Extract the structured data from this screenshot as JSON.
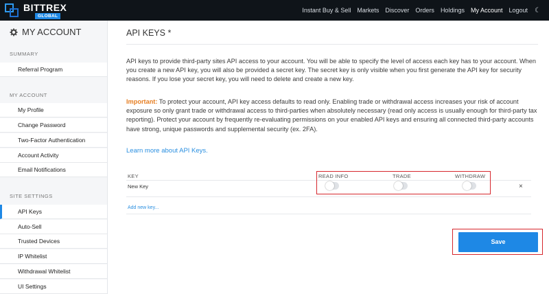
{
  "brand": {
    "name": "BITTREX",
    "sub": "GLOBAL"
  },
  "topnav": {
    "items": [
      "Instant Buy & Sell",
      "Markets",
      "Discover",
      "Orders",
      "Holdings",
      "My Account",
      "Logout"
    ],
    "active": "My Account",
    "theme_icon": "moon-icon"
  },
  "sidebar": {
    "title": "MY ACCOUNT",
    "title_icon": "gear-icon",
    "sections": [
      {
        "label": "SUMMARY",
        "items": [
          "Referral Program"
        ]
      },
      {
        "label": "MY ACCOUNT",
        "items": [
          "My Profile",
          "Change Password",
          "Two-Factor Authentication",
          "Account Activity",
          "Email Notifications"
        ]
      },
      {
        "label": "SITE SETTINGS",
        "items": [
          "API Keys",
          "Auto-Sell",
          "Trusted Devices",
          "IP Whitelist",
          "Withdrawal Whitelist",
          "UI Settings"
        ]
      }
    ],
    "active_item": "API Keys"
  },
  "main": {
    "title": "API KEYS *",
    "intro": "API keys to provide third-party sites API access to your account. You will be able to specify the level of access each key has to your account. When you create a new API key, you will also be provided a secret key. The secret key is only visible when you first generate the API key for security reasons. If you lose your secret key, you will need to delete and create a new key.",
    "important_label": "Important:",
    "important_text": " To protect your account, API key access defaults to read only. Enabling trade or withdrawal access increases your risk of account exposure so only grant trade or withdrawal access to third-parties when absolutely necessary (read only access is usually enough for third-party tax reporting). Protect your account by frequently re-evaluating permissions on your enabled API keys and ensuring all connected third-party accounts have strong, unique passwords and supplemental security (ex. 2FA).",
    "learn_more": "Learn more about API Keys.",
    "table": {
      "headers": [
        "KEY",
        "READ INFO",
        "TRADE",
        "WITHDRAW"
      ],
      "rows": [
        {
          "key": "New Key",
          "read_info": false,
          "trade": false,
          "withdraw": false,
          "delete": "×"
        }
      ],
      "add_link": "Add new key..."
    },
    "save_label": "Save"
  },
  "colors": {
    "accent": "#1e88e5",
    "topbar": "#0f1419",
    "important": "#e67e22",
    "highlight": "#d6262c",
    "link": "#2a8fe0"
  }
}
